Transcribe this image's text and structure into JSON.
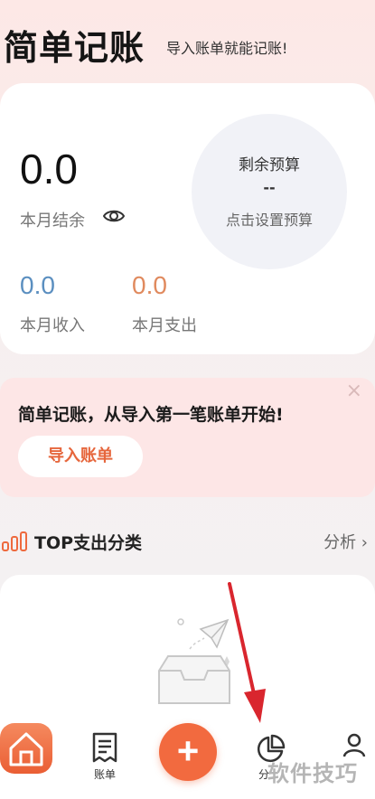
{
  "header": {
    "title": "简单记账",
    "subtitle": "导入账单就能记账!"
  },
  "summary": {
    "balance_value": "0.0",
    "balance_label": "本月结余",
    "budget_title": "剩余预算",
    "budget_value": "--",
    "budget_hint": "点击设置预算",
    "income_value": "0.0",
    "income_label": "本月收入",
    "expense_value": "0.0",
    "expense_label": "本月支出"
  },
  "banner": {
    "text": "简单记账，从导入第一笔账单开始!",
    "button": "导入账单",
    "close": "×"
  },
  "section": {
    "title": "TOP支出分类",
    "link": "分析 ›"
  },
  "tabbar": {
    "bills_label": "账单",
    "add_symbol": "+",
    "analysis_label": "分"
  },
  "watermark": "软件技巧",
  "colors": {
    "accent": "#f26a3f",
    "income": "#5b8fc0",
    "expense": "#e08a5e",
    "arrow": "#d9262e"
  },
  "icons": [
    "eye-icon",
    "bar-chart-icon",
    "home-icon",
    "bill-icon",
    "plus-icon",
    "pie-chart-icon",
    "user-icon",
    "paper-plane-icon",
    "inbox-icon"
  ]
}
